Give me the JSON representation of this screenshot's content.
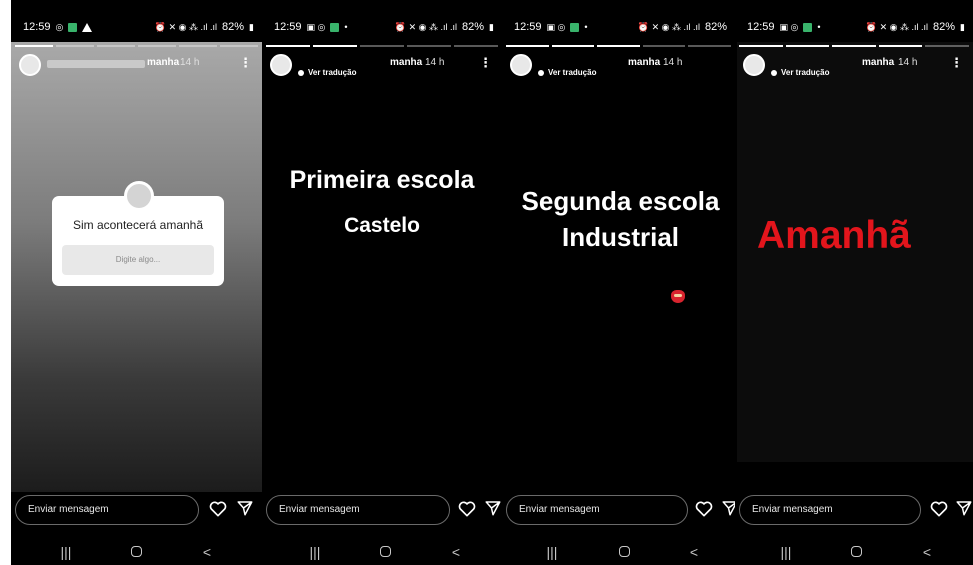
{
  "status_bar": {
    "time": "12:59",
    "battery": "82%"
  },
  "stories": [
    {
      "username": "manha",
      "time_ago": "14 h",
      "question_sticker": {
        "title": "Sim acontecerá amanhã",
        "placeholder": "Digite algo..."
      }
    },
    {
      "username": "manha",
      "time_ago": "14 h",
      "translate_label": "Ver tradução",
      "lines": [
        "Primeira escola",
        "Castelo"
      ]
    },
    {
      "username": "manha",
      "time_ago": "14 h",
      "translate_label": "Ver tradução",
      "lines": [
        "Segunda escola",
        "Industrial"
      ]
    },
    {
      "username": "manha",
      "time_ago": "14 h",
      "translate_label": "Ver tradução",
      "lines": [
        "Amanhã"
      ],
      "text_color": "#e3151c"
    }
  ],
  "message_bar": {
    "placeholder": "Enviar mensagem"
  },
  "icons": {
    "heart": "heart-icon",
    "send": "send-icon",
    "more": "more-vertical-icon"
  },
  "nav": {
    "recents": "|||",
    "home": "home",
    "back": "<"
  }
}
